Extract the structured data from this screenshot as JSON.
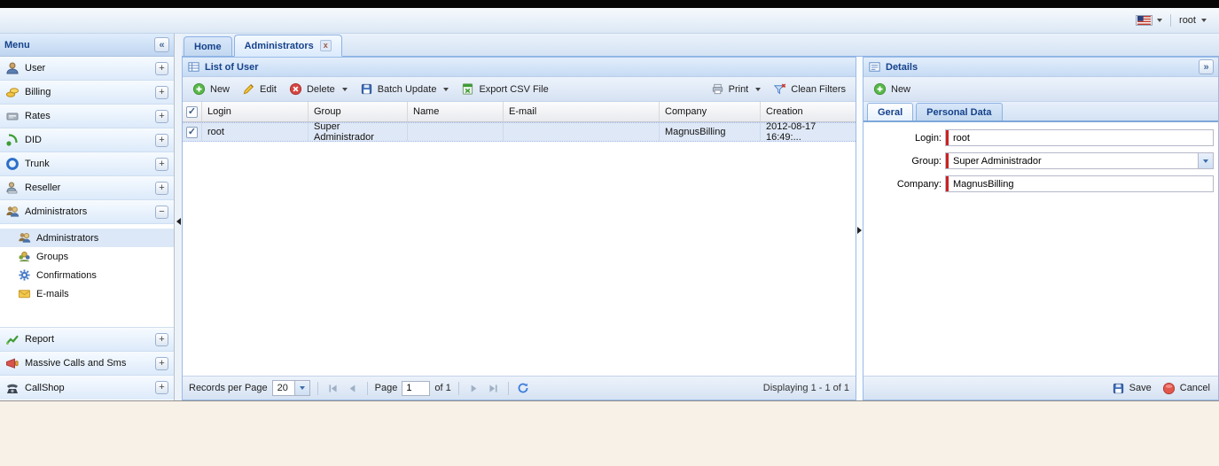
{
  "colors": {
    "accent": "#15428b",
    "selection": "#dfe8f6",
    "required_marker": "#cc2222",
    "body_bg": "#f8f1e7",
    "topbar": "#060606"
  },
  "topbar": {
    "user": "root",
    "language_icon": "us-flag-icon"
  },
  "ui": {
    "collapse_left": "«",
    "collapse_right": "»",
    "plus": "+",
    "minus": "−",
    "close": "x",
    "check": "✓"
  },
  "sidebar": {
    "title": "Menu",
    "items": [
      {
        "label": "User",
        "icon": "user-icon"
      },
      {
        "label": "Billing",
        "icon": "coins-icon"
      },
      {
        "label": "Rates",
        "icon": "rates-icon"
      },
      {
        "label": "DID",
        "icon": "did-icon"
      },
      {
        "label": "Trunk",
        "icon": "trunk-icon"
      },
      {
        "label": "Reseller",
        "icon": "reseller-icon"
      },
      {
        "label": "Administrators",
        "icon": "administrators-icon",
        "expanded": true
      },
      {
        "label": "Report",
        "icon": "report-icon"
      },
      {
        "label": "Massive Calls and Sms",
        "icon": "megaphone-icon"
      },
      {
        "label": "CallShop",
        "icon": "phone-icon"
      }
    ],
    "subitems": [
      {
        "label": "Administrators",
        "icon": "administrators-icon",
        "selected": true
      },
      {
        "label": "Groups",
        "icon": "groups-icon"
      },
      {
        "label": "Confirmations",
        "icon": "gear-icon"
      },
      {
        "label": "E-mails",
        "icon": "envelope-icon"
      }
    ]
  },
  "tabs": [
    {
      "label": "Home",
      "active": false
    },
    {
      "label": "Administrators",
      "active": true,
      "closable": true
    }
  ],
  "list": {
    "title": "List of User",
    "toolbar": {
      "new": "New",
      "edit": "Edit",
      "delete": "Delete",
      "batch_update": "Batch Update",
      "export_csv": "Export CSV File",
      "print": "Print",
      "clean_filters": "Clean Filters"
    },
    "columns": [
      "Login",
      "Group",
      "Name",
      "E-mail",
      "Company",
      "Creation"
    ],
    "rows": [
      {
        "login": "root",
        "group": "Super Administrador",
        "name": "",
        "email": "",
        "company": "MagnusBilling",
        "creation": "2012-08-17 16:49:..."
      }
    ],
    "paging": {
      "records_per_page_label": "Records per Page",
      "records_per_page_value": "20",
      "page_label": "Page",
      "page_value": "1",
      "of_label": "of 1",
      "displaying": "Displaying 1 - 1 of 1"
    }
  },
  "details": {
    "title": "Details",
    "toolbar": {
      "new": "New"
    },
    "tabs": [
      {
        "label": "Geral",
        "active": true
      },
      {
        "label": "Personal Data",
        "active": false
      }
    ],
    "fields": [
      {
        "label": "Login:",
        "value": "root",
        "type": "text"
      },
      {
        "label": "Group:",
        "value": "Super Administrador",
        "type": "select"
      },
      {
        "label": "Company:",
        "value": "MagnusBilling",
        "type": "text"
      }
    ],
    "footer": {
      "save": "Save",
      "cancel": "Cancel"
    }
  }
}
